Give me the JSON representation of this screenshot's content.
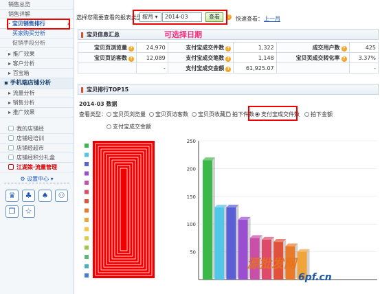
{
  "sidebar": {
    "top_items": [
      "销售总览",
      "销售详解"
    ],
    "active_item": "宝贝销售排行",
    "sub_items": [
      "买家购买分析",
      "促销手段分析"
    ],
    "groups_a": [
      "推广效果",
      "客户分析",
      "百宝箱"
    ],
    "mobile_head": "手机端店铺分析",
    "mobile_items": [
      "流量分析",
      "销售分析",
      "推广效果"
    ],
    "links": [
      "我的店铺经",
      "店铺经培训",
      "店铺经超市",
      "店铺经积分礼盒"
    ],
    "highlight_link": "江湖策·流量管理",
    "settings_label": "设置中心"
  },
  "filter": {
    "label": "选择您需要查看的报表类型：",
    "period": "按月",
    "date": "2014-03",
    "view_button": "查看",
    "quick_label": "快速查看：",
    "prev_link": "上一月"
  },
  "annotation": "可选择日期",
  "info": {
    "title": "宝贝信息汇总",
    "rows": [
      [
        "宝贝页浏览量",
        "24,970",
        "支付宝成交件数",
        "1,322",
        "成交用户数",
        "425"
      ],
      [
        "宝贝页访客数",
        "12,089",
        "支付宝成交笔数",
        "1,148",
        "宝贝页成交转化率",
        "3.37%"
      ],
      [
        "",
        "-",
        "支付宝成交金额",
        "61,925.07",
        "",
        "-"
      ]
    ]
  },
  "ranking": {
    "title": "宝贝排行TOP15",
    "data_label": "2014-03 数据",
    "view_type_label": "查看类型：",
    "options": [
      "宝贝页浏览量",
      "宝贝页访客数",
      "宝贝页收藏量",
      "拍下件数",
      "支付宝成交件数",
      "拍下金额",
      "支付宝成交金额"
    ],
    "selected": "支付宝成交件数"
  },
  "chart_data": {
    "type": "bar",
    "categories": [
      "1",
      "2",
      "3",
      "4",
      "5",
      "6",
      "7",
      "8",
      "9",
      "10",
      "11",
      "12",
      "13",
      "14",
      "15"
    ],
    "values": [
      215,
      130,
      130,
      108,
      75,
      72,
      68,
      60,
      50,
      0,
      0,
      0,
      0,
      0,
      0
    ],
    "ytick_labels": [
      "250",
      "200",
      "150",
      "100",
      "50"
    ],
    "ylim": [
      0,
      250
    ],
    "colors": [
      "#3cb84a",
      "#52c6e6",
      "#5a5fd6",
      "#9a4fd0",
      "#c94fa8",
      "#e04a6a",
      "#e0523c",
      "#e87a2a",
      "#f0a43a",
      "#f5c64a",
      "#d7d04a",
      "#9cc84a",
      "#58b878",
      "#48b0b8",
      "#4a7ad8"
    ]
  },
  "watermark": {
    "line1": "源批发网",
    "line2": "6pf.cn"
  }
}
